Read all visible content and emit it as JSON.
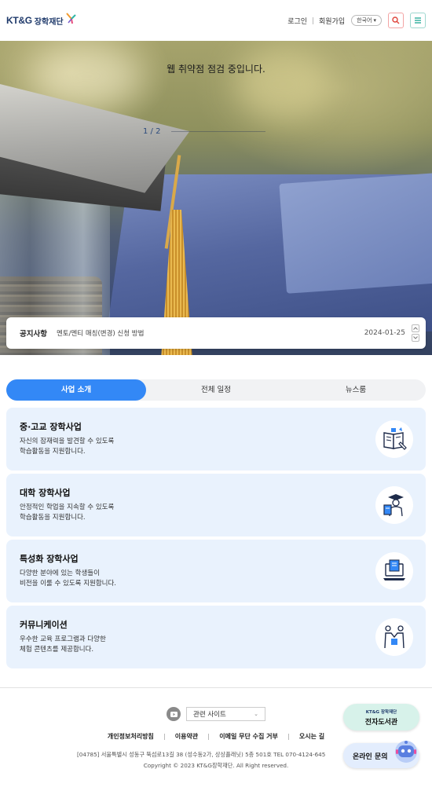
{
  "header": {
    "logo_kt": "KT&G",
    "logo_name": "장학재단",
    "login": "로그인",
    "signup": "회원가입",
    "language": "한국어"
  },
  "hero": {
    "caption": "웹 취약점 점검 중입니다.",
    "pager": "1 / 2"
  },
  "notice": {
    "label": "공지사항",
    "text": "멘토/멘티 매칭(변경) 신청 방법",
    "date": "2024-01-25"
  },
  "tabs": [
    {
      "label": "사업 소개",
      "active": true
    },
    {
      "label": "전체 일정",
      "active": false
    },
    {
      "label": "뉴스룸",
      "active": false
    }
  ],
  "cards": [
    {
      "title": "중·고교 장학사업",
      "line1": "자신의 잠재력을 발견할 수 있도록",
      "line2": "학습활동을 지원합니다.",
      "icon": "book-pen-icon"
    },
    {
      "title": "대학 장학사업",
      "line1": "안정적인 학업을 지속할 수 있도록",
      "line2": "학습활동을 지원합니다.",
      "icon": "graduate-icon"
    },
    {
      "title": "특성화 장학사업",
      "line1": "다양한 분야에 있는 학생들이",
      "line2": "비전을 이룰 수 있도록 지원합니다.",
      "icon": "laptop-book-icon"
    },
    {
      "title": "커뮤니케이션",
      "line1": "우수한 교육 프로그램과 다양한",
      "line2": "체험 콘텐츠를 제공합니다.",
      "icon": "handshake-icon"
    }
  ],
  "footer": {
    "related_sites": "관련 사이트",
    "links": [
      "개인정보처리방침",
      "이용약관",
      "이메일 무단 수집 거부",
      "오시는 길"
    ],
    "address": "[04785] 서울특별시 성동구 뚝섬로13길 38 (성수동2가, 상상플래닛) 5층 501호 TEL 070-4124-645",
    "copyright": "Copyright © 2023 KT&G장학재단. All Right reserved."
  },
  "floating": {
    "ebook_logo": "KT&G 장학재단",
    "ebook_label": "전자도서관",
    "chat_label": "온라인 문의"
  },
  "colors": {
    "accent": "#3388f6",
    "card_bg": "#e9f2fd",
    "brand": "#1f3a6b"
  }
}
